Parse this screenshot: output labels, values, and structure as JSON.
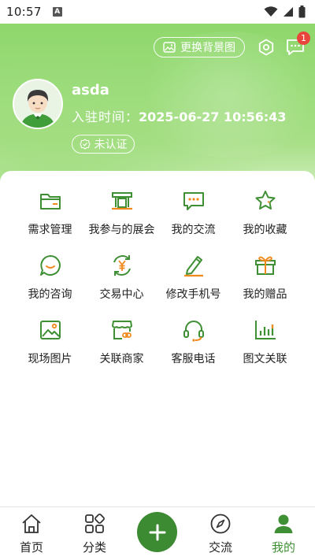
{
  "status_bar": {
    "time": "10:57",
    "notification_letter": "A"
  },
  "header": {
    "change_bg_label": "更换背景图",
    "message_badge": "1",
    "username": "asda",
    "join_label": "入驻时间：",
    "join_time": "2025-06-27 10:56:43",
    "verify_label": "未认证"
  },
  "grid": [
    {
      "label": "需求管理",
      "icon": "folder-icon"
    },
    {
      "label": "我参与的展会",
      "icon": "booth-icon"
    },
    {
      "label": "我的交流",
      "icon": "chat-icon"
    },
    {
      "label": "我的收藏",
      "icon": "star-icon"
    },
    {
      "label": "我的咨询",
      "icon": "consult-icon"
    },
    {
      "label": "交易中心",
      "icon": "yuan-icon"
    },
    {
      "label": "修改手机号",
      "icon": "pencil-icon"
    },
    {
      "label": "我的赠品",
      "icon": "gift-icon"
    },
    {
      "label": "现场图片",
      "icon": "image-icon"
    },
    {
      "label": "关联商家",
      "icon": "shop-link-icon"
    },
    {
      "label": "客服电话",
      "icon": "headset-icon"
    },
    {
      "label": "图文关联",
      "icon": "bar-chart-icon"
    }
  ],
  "bottom_nav": {
    "home": "首页",
    "category": "分类",
    "exchange": "交流",
    "mine": "我的"
  },
  "colors": {
    "accent": "#3c8a31",
    "icon_green": "#3f8f34",
    "icon_orange": "#f08a1c",
    "header_green": "#8fd76c",
    "badge_red": "#e8453c"
  }
}
